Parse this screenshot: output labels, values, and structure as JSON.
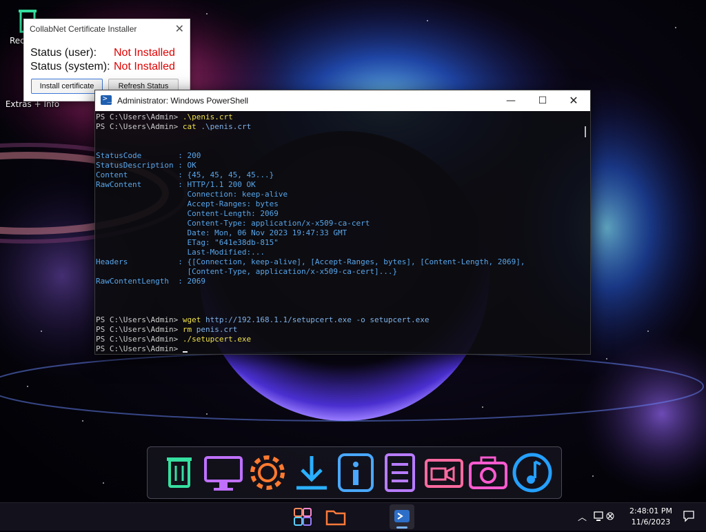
{
  "desktop": {
    "recycle_label": "Rec",
    "extras_label": "Extras + Info"
  },
  "installer": {
    "title": "CollabNet Certificate Installer",
    "close_glyph": "✕",
    "status_user_label": "Status (user):",
    "status_user_value": "Not Installed",
    "status_system_label": "Status (system):",
    "status_system_value": "Not Installed",
    "install_button": "Install certificate",
    "refresh_button": "Refresh Status",
    "status_color": "#e00000"
  },
  "powershell": {
    "title": "Administrator: Windows PowerShell",
    "minimize_glyph": "—",
    "maximize_glyph": "☐",
    "close_glyph": "✕",
    "lines": [
      {
        "prompt": "PS C:\\Users\\Admin> ",
        "cmd": ".\\penis.crt",
        "args": "",
        "out": ""
      },
      {
        "prompt": "PS C:\\Users\\Admin> ",
        "cmd": "cat",
        "args": " .\\penis.crt",
        "out": ""
      },
      {
        "prompt": "",
        "cmd": "",
        "args": "",
        "out": ""
      },
      {
        "prompt": "",
        "cmd": "",
        "args": "",
        "out": ""
      },
      {
        "prompt": "",
        "cmd": "",
        "args": "",
        "out": "StatusCode        : 200"
      },
      {
        "prompt": "",
        "cmd": "",
        "args": "",
        "out": "StatusDescription : OK"
      },
      {
        "prompt": "",
        "cmd": "",
        "args": "",
        "out": "Content           : {45, 45, 45, 45...}"
      },
      {
        "prompt": "",
        "cmd": "",
        "args": "",
        "out": "RawContent        : HTTP/1.1 200 OK"
      },
      {
        "prompt": "",
        "cmd": "",
        "args": "",
        "out": "                    Connection: keep-alive"
      },
      {
        "prompt": "",
        "cmd": "",
        "args": "",
        "out": "                    Accept-Ranges: bytes"
      },
      {
        "prompt": "",
        "cmd": "",
        "args": "",
        "out": "                    Content-Length: 2069"
      },
      {
        "prompt": "",
        "cmd": "",
        "args": "",
        "out": "                    Content-Type: application/x-x509-ca-cert"
      },
      {
        "prompt": "",
        "cmd": "",
        "args": "",
        "out": "                    Date: Mon, 06 Nov 2023 19:47:33 GMT"
      },
      {
        "prompt": "",
        "cmd": "",
        "args": "",
        "out": "                    ETag: \"641e38db-815\""
      },
      {
        "prompt": "",
        "cmd": "",
        "args": "",
        "out": "                    Last-Modified:..."
      },
      {
        "prompt": "",
        "cmd": "",
        "args": "",
        "out": "Headers           : {[Connection, keep-alive], [Accept-Ranges, bytes], [Content-Length, 2069],"
      },
      {
        "prompt": "",
        "cmd": "",
        "args": "",
        "out": "                    [Content-Type, application/x-x509-ca-cert]...}"
      },
      {
        "prompt": "",
        "cmd": "",
        "args": "",
        "out": "RawContentLength  : 2069"
      },
      {
        "prompt": "",
        "cmd": "",
        "args": "",
        "out": ""
      },
      {
        "prompt": "",
        "cmd": "",
        "args": "",
        "out": ""
      },
      {
        "prompt": "",
        "cmd": "",
        "args": "",
        "out": ""
      },
      {
        "prompt": "PS C:\\Users\\Admin> ",
        "cmd": "wget",
        "args": " http://192.168.1.1/setupcert.exe -o setupcert.exe",
        "out": ""
      },
      {
        "prompt": "PS C:\\Users\\Admin> ",
        "cmd": "rm",
        "args": " penis.crt",
        "out": ""
      },
      {
        "prompt": "PS C:\\Users\\Admin> ",
        "cmd": "./setupcert.exe",
        "args": "",
        "out": ""
      },
      {
        "prompt": "PS C:\\Users\\Admin> ",
        "cmd": "",
        "args": "",
        "out": "",
        "cursor": true
      }
    ]
  },
  "dock": {
    "items": [
      {
        "icon": "recycle-bin-icon",
        "color": "#36e0a0"
      },
      {
        "icon": "monitor-icon",
        "color": "#c070ff"
      },
      {
        "icon": "gear-icon",
        "color": "#ff7a30"
      },
      {
        "icon": "download-icon",
        "color": "#2ab0ff"
      },
      {
        "icon": "info-icon",
        "color": "#4aa8ff"
      },
      {
        "icon": "document-icon",
        "color": "#b87cff"
      },
      {
        "icon": "video-icon",
        "color": "#ff6aa0"
      },
      {
        "icon": "camera-icon",
        "color": "#ff5ad0"
      },
      {
        "icon": "music-icon",
        "color": "#25a0ff"
      }
    ]
  },
  "taskbar": {
    "time": "2:48:01 PM",
    "date": "11/6/2023",
    "tray_chevron": "︿"
  }
}
